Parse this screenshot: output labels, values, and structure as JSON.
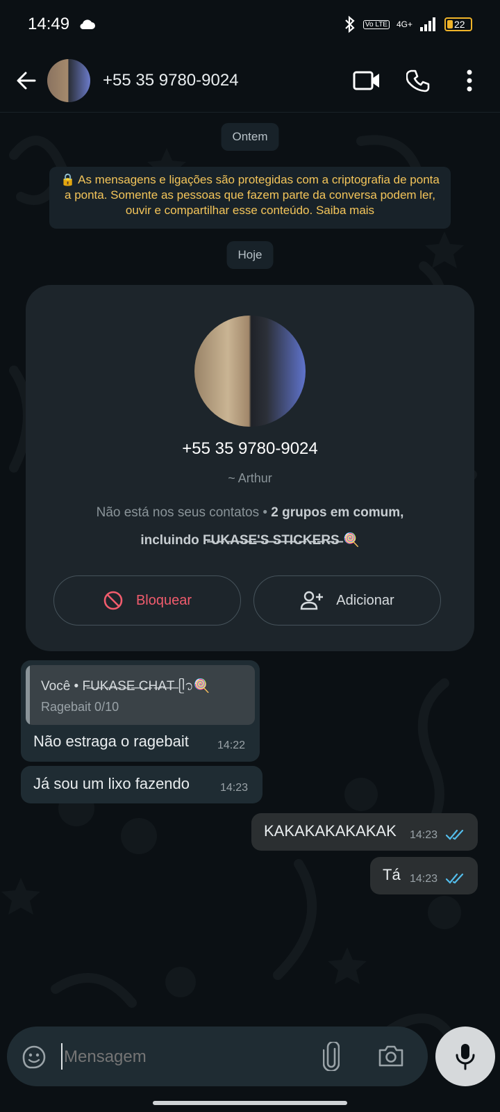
{
  "status_bar": {
    "time": "14:49",
    "network_labels": [
      "Vo LTE",
      "4G+"
    ],
    "battery": "22",
    "icons": [
      "cloud-icon",
      "bluetooth-icon",
      "signal-icon",
      "battery-icon"
    ]
  },
  "header": {
    "contact_name": "+55 35 9780-9024",
    "icons": [
      "back-arrow-icon",
      "video-call-icon",
      "phone-icon",
      "more-vert-icon"
    ]
  },
  "chat": {
    "date_yesterday": "Ontem",
    "encryption_notice": "🔒 As mensagens e ligações são protegidas com a criptografia de ponta a ponta. Somente as pessoas que fazem parte da conversa podem ler, ouvir e compartilhar esse conteúdo. Saiba mais",
    "date_today": "Hoje"
  },
  "contact_card": {
    "phone": "+55 35 9780-9024",
    "alias": "~ Arthur",
    "info_prefix": "Não está nos seus contatos • ",
    "info_bold_1": "2 grupos em comum,",
    "info_bold_2": "incluindo F̶U̶K̶A̶S̶E̶'̶S̶ ̶S̶T̶I̶C̶K̶E̶R̶S̶ 🍭",
    "block_label": "Bloquear",
    "add_label": "Adicionar"
  },
  "messages": [
    {
      "direction": "in",
      "quote_author": "Você • F̶U̶K̶A̶S̶E̶ ̶C̶H̶A̶T̶ ᥫ᭡🍭",
      "quote_text": "Ragebait 0/10",
      "text": "Não estraga o ragebait",
      "time": "14:22"
    },
    {
      "direction": "in",
      "text": "Já sou um lixo fazendo",
      "time": "14:23"
    },
    {
      "direction": "out",
      "text": "KAKAKAKAKAKAK",
      "time": "14:23",
      "status": "read"
    },
    {
      "direction": "out",
      "text": "Tá",
      "time": "14:23",
      "status": "read"
    }
  ],
  "composer": {
    "placeholder": "Mensagem",
    "icons": [
      "sticker-icon",
      "attach-icon",
      "camera-icon",
      "mic-icon"
    ]
  },
  "colors": {
    "background": "#0b1014",
    "bubble_in": "#1f2c33",
    "bubble_out": "#2b2f31",
    "notice_text": "#f4c55a",
    "block_red": "#f15c6d",
    "read_ticks": "#53bdeb"
  }
}
